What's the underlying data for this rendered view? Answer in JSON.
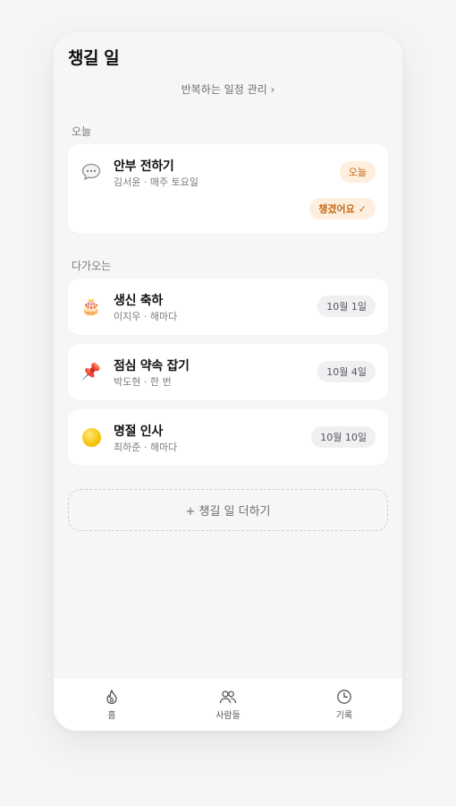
{
  "header": {
    "title": "챙길 일",
    "manage_link": "반복하는 일정 관리 ›"
  },
  "sections": {
    "today_label": "오늘",
    "upcoming_label": "다가오는"
  },
  "today_card": {
    "icon": "speech-bubble-icon",
    "title": "안부 전하기",
    "sub": "김서윤 · 매주 토요일",
    "badge": "오늘",
    "done_label": "챙겼어요",
    "done_check": "✓"
  },
  "upcoming": [
    {
      "icon": "cake-icon",
      "emoji": "🎂",
      "title": "생신 축하",
      "sub": "이지우 · 해마다",
      "date": "10월 1일"
    },
    {
      "icon": "pushpin-icon",
      "emoji": "📌",
      "title": "점심 약속 잡기",
      "sub": "박도현 · 한 번",
      "date": "10월 4일"
    },
    {
      "icon": "sun-icon",
      "emoji": "",
      "title": "명절 인사",
      "sub": "최하준 · 해마다",
      "date": "10월 10일"
    }
  ],
  "add_button": "+ 챙길 일 더하기",
  "tabs": [
    {
      "label": "홈",
      "icon": "flame-icon"
    },
    {
      "label": "사람들",
      "icon": "people-icon"
    },
    {
      "label": "기록",
      "icon": "clock-icon"
    }
  ],
  "colors": {
    "accent": "#c46a17",
    "accent_bg": "#fdeedd",
    "card_bg": "#ffffff",
    "page_bg": "#f6f6f7"
  }
}
